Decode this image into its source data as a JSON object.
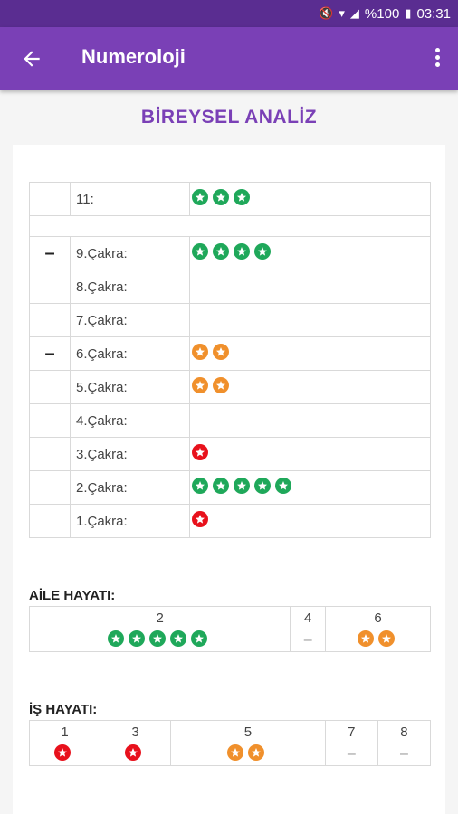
{
  "status_bar": {
    "battery": "%100",
    "time": "03:31"
  },
  "app_bar": {
    "title": "Numeroloji"
  },
  "page": {
    "heading": "BİREYSEL ANALİZ"
  },
  "chakra_rows": [
    {
      "mark": "",
      "label": "11:",
      "stars": 3,
      "color": "green"
    },
    {
      "spacer": true
    },
    {
      "mark": "–",
      "label": "9.Çakra:",
      "stars": 4,
      "color": "green"
    },
    {
      "mark": "",
      "label": "8.Çakra:",
      "stars": 0,
      "color": ""
    },
    {
      "mark": "",
      "label": "7.Çakra:",
      "stars": 0,
      "color": ""
    },
    {
      "mark": "–",
      "label": "6.Çakra:",
      "stars": 2,
      "color": "orange"
    },
    {
      "mark": "",
      "label": "5.Çakra:",
      "stars": 2,
      "color": "orange"
    },
    {
      "mark": "",
      "label": "4.Çakra:",
      "stars": 0,
      "color": ""
    },
    {
      "mark": "",
      "label": "3.Çakra:",
      "stars": 1,
      "color": "red"
    },
    {
      "mark": "",
      "label": "2.Çakra:",
      "stars": 5,
      "color": "green"
    },
    {
      "mark": "",
      "label": "1.Çakra:",
      "stars": 1,
      "color": "red"
    }
  ],
  "aile": {
    "title": "AİLE HAYATI:",
    "columns": [
      {
        "header": "2",
        "stars": 5,
        "color": "green",
        "dash": ""
      },
      {
        "header": "4",
        "stars": 0,
        "color": "",
        "dash": "–"
      },
      {
        "header": "6",
        "stars": 2,
        "color": "orange",
        "dash": ""
      }
    ]
  },
  "is": {
    "title": "İŞ HAYATI:",
    "columns": [
      {
        "header": "1",
        "stars": 1,
        "color": "red",
        "dash": ""
      },
      {
        "header": "3",
        "stars": 1,
        "color": "red",
        "dash": ""
      },
      {
        "header": "5",
        "stars": 2,
        "color": "orange",
        "dash": ""
      },
      {
        "header": "7",
        "stars": 0,
        "color": "",
        "dash": "–"
      },
      {
        "header": "8",
        "stars": 0,
        "color": "",
        "dash": "–"
      }
    ]
  },
  "colors": {
    "green": "#1fa85a",
    "orange": "#f0902c",
    "red": "#e8111c",
    "primary": "#7a40b6"
  },
  "icons": {
    "back": "arrow-left-icon",
    "menu": "more-vert-icon",
    "star": "star-badge-icon"
  }
}
